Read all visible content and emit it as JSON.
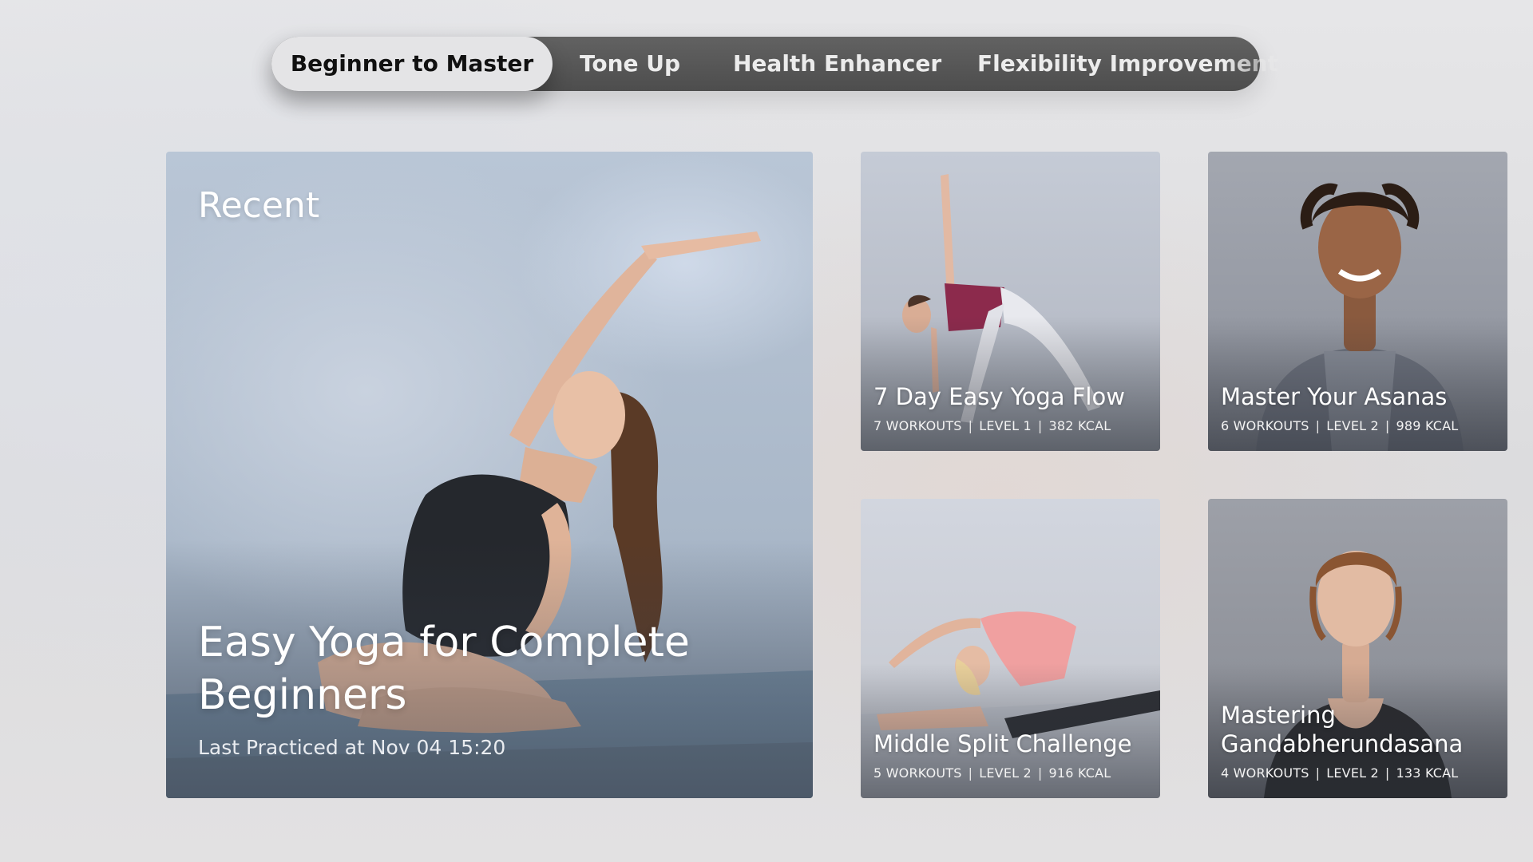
{
  "tabs": [
    {
      "label": "Beginner to Master",
      "active": true
    },
    {
      "label": "Tone Up",
      "active": false
    },
    {
      "label": "Health Enhancer",
      "active": false
    },
    {
      "label": "Flexibility Improvement",
      "active": false
    }
  ],
  "featured": {
    "section_label": "Recent",
    "title": "Easy Yoga for Complete Beginners",
    "subtitle": "Last Practiced at Nov 04 15:20"
  },
  "programs": [
    {
      "title": "7 Day Easy Yoga Flow",
      "workouts": "7 WORKOUTS",
      "level": "LEVEL 1",
      "kcal": "382 KCAL"
    },
    {
      "title": "Master Your Asanas",
      "workouts": "6 WORKOUTS",
      "level": "LEVEL 2",
      "kcal": "989 KCAL"
    },
    {
      "title": "Middle Split Challenge",
      "workouts": "5 WORKOUTS",
      "level": "LEVEL 2",
      "kcal": "916 KCAL"
    },
    {
      "title": "Mastering Gandabherundasana",
      "workouts": "4 WORKOUTS",
      "level": "LEVEL 2",
      "kcal": "133 KCAL"
    }
  ],
  "separator": "|",
  "colors": {
    "tab_bar": "#555555",
    "tab_active": "#e4e4e6",
    "text_light": "#ffffff"
  },
  "icons": {
    "featured_image": "yoga-side-stretch-photo",
    "program_images": [
      "triangle-pose-photo",
      "instructor-portrait-photo",
      "split-stretch-photo",
      "instructor-portrait-photo"
    ]
  }
}
